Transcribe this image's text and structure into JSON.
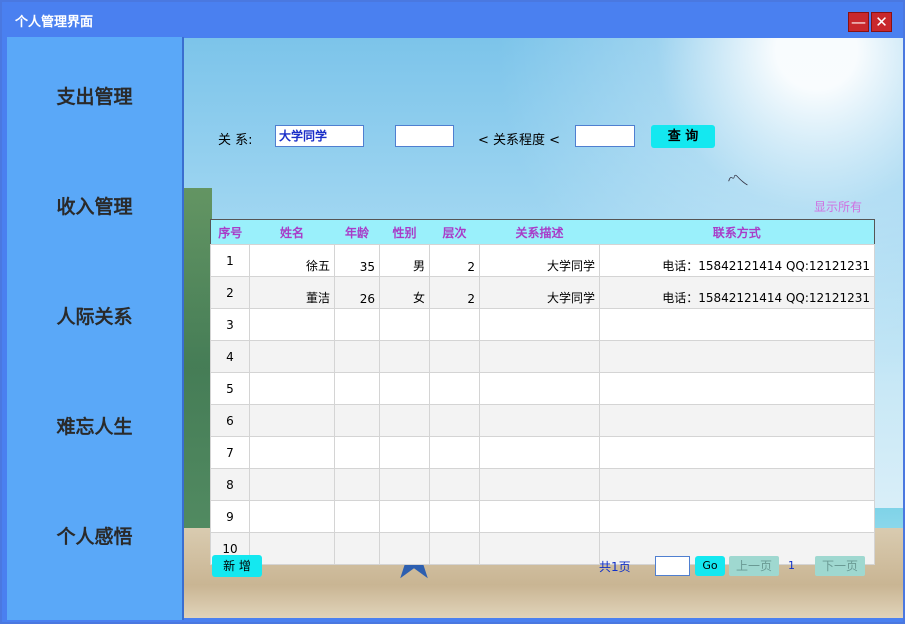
{
  "window": {
    "title": "个人管理界面",
    "minimize": "—",
    "close": "✕"
  },
  "sidebar": {
    "items": [
      {
        "label": "支出管理"
      },
      {
        "label": "收入管理"
      },
      {
        "label": "人际关系"
      },
      {
        "label": "难忘人生"
      },
      {
        "label": "个人感悟"
      }
    ]
  },
  "filter": {
    "relation_label": "关 系:",
    "relation_value": "大学同学",
    "min_value": "",
    "degree_label": "< 关系程度 <",
    "max_value": "",
    "query_button": "查 询"
  },
  "show_all_link": "显示所有",
  "table": {
    "headers": [
      "序号",
      "姓名",
      "年龄",
      "性别",
      "层次",
      "关系描述",
      "联系方式"
    ],
    "rows": [
      [
        "1",
        "徐五",
        "35",
        "男",
        "2",
        "大学同学",
        "电话：15842121414 QQ:12121231"
      ],
      [
        "2",
        "董洁",
        "26",
        "女",
        "2",
        "大学同学",
        "电话：15842121414 QQ:12121231"
      ],
      [
        "3",
        "",
        "",
        "",
        "",
        "",
        ""
      ],
      [
        "4",
        "",
        "",
        "",
        "",
        "",
        ""
      ],
      [
        "5",
        "",
        "",
        "",
        "",
        "",
        ""
      ],
      [
        "6",
        "",
        "",
        "",
        "",
        "",
        ""
      ],
      [
        "7",
        "",
        "",
        "",
        "",
        "",
        ""
      ],
      [
        "8",
        "",
        "",
        "",
        "",
        "",
        ""
      ],
      [
        "9",
        "",
        "",
        "",
        "",
        "",
        ""
      ],
      [
        "10",
        "",
        "",
        "",
        "",
        "",
        ""
      ]
    ]
  },
  "footer": {
    "add_button": "新 增",
    "total_pages": "共1页",
    "page_input": "",
    "go_button": "Go",
    "prev_button": "上一页",
    "current_page": "1",
    "next_button": "下一页"
  },
  "icons": {
    "bird": "bird-decoration",
    "starfish": "starfish-decoration"
  }
}
